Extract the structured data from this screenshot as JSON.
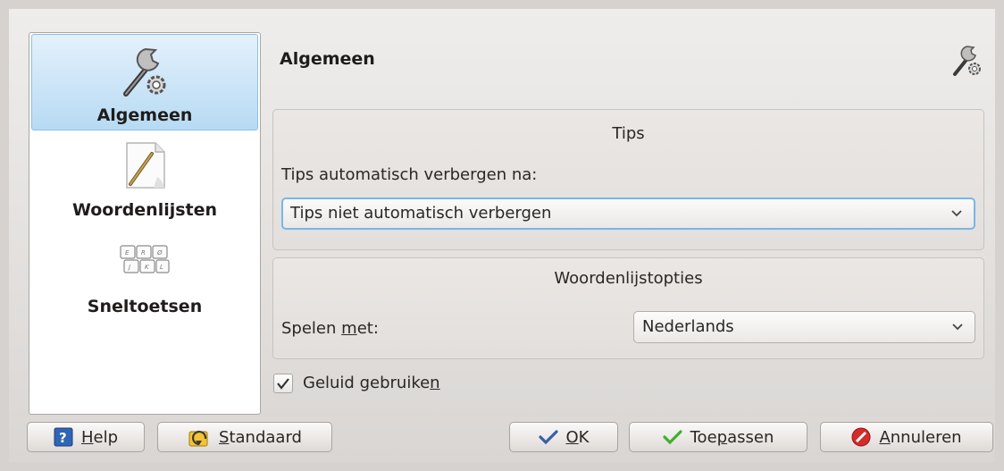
{
  "sidebar": {
    "items": [
      {
        "label": "Algemeen",
        "icon": "wrench-gear-icon",
        "active": true
      },
      {
        "label": "Woordenlijsten",
        "icon": "pencil-document-icon",
        "active": false
      },
      {
        "label": "Sneltoetsen",
        "icon": "keyboard-icon",
        "active": false
      }
    ]
  },
  "page": {
    "title": "Algemeen",
    "icon": "wrench-gear-icon"
  },
  "tips_group": {
    "title": "Tips",
    "hide_label": "Tips automatisch verbergen na:",
    "hide_value": "Tips niet automatisch verbergen"
  },
  "dict_group": {
    "title": "Woordenlijstopties",
    "play_with_label_pre": "Spelen ",
    "play_with_label_mnemonic": "m",
    "play_with_label_post": "et:",
    "play_with_value": "Nederlands"
  },
  "sound": {
    "checked": true,
    "label_pre": "Geluid gebruike",
    "label_mnemonic": "n"
  },
  "buttons": {
    "help_mnemonic": "H",
    "help_rest": "elp",
    "defaults_mnemonic": "S",
    "defaults_rest": "tandaard",
    "ok_mnemonic": "O",
    "ok_rest": "K",
    "apply_pre": "Toe",
    "apply_mnemonic": "p",
    "apply_post": "assen",
    "cancel_mnemonic": "A",
    "cancel_rest": "nnuleren"
  },
  "colors": {
    "selection": "#b7daf3",
    "focus": "#78b6e8",
    "apply_check": "#3fb02b",
    "cancel": "#d42b2b"
  }
}
